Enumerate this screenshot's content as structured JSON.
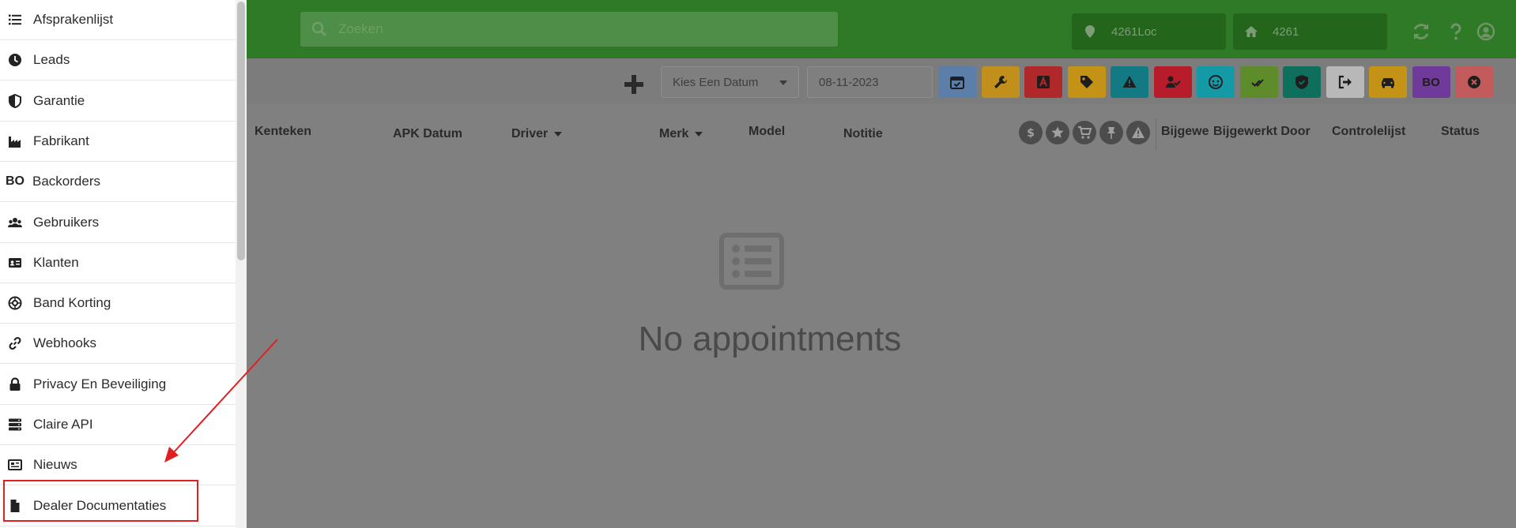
{
  "topbar": {
    "search_placeholder": "Zoeken",
    "location": "4261Loc",
    "home": "4261",
    "icons": [
      "refresh-icon",
      "help-icon",
      "user-icon"
    ],
    "color": "#2f7a27"
  },
  "toolbar": {
    "date_select": "Kies Een Datum",
    "date_value": "08-11-2023",
    "filter_buttons": [
      {
        "name": "calendar",
        "color": "#5b7fa8"
      },
      {
        "name": "wrench",
        "color": "#c08f1c"
      },
      {
        "name": "letter-a",
        "color": "#b1282a"
      },
      {
        "name": "tag",
        "color": "#c49316"
      },
      {
        "name": "warning",
        "color": "#137a84"
      },
      {
        "name": "user-check",
        "color": "#b71c2a"
      },
      {
        "name": "face",
        "color": "#139aa6"
      },
      {
        "name": "double-check",
        "color": "#5f8c2a"
      },
      {
        "name": "shield",
        "color": "#0d6f5c"
      },
      {
        "name": "sign-out",
        "color": "#b8b8b8"
      },
      {
        "name": "car",
        "color": "#c49316"
      },
      {
        "name": "bo",
        "label": "BO",
        "color": "#6f3a9a"
      },
      {
        "name": "close",
        "color": "#c25c5c"
      }
    ]
  },
  "table": {
    "columns": {
      "kenteken": "Kenteken",
      "apk_datum": "APK Datum",
      "driver": "Driver",
      "merk": "Merk",
      "model": "Model",
      "notitie": "Notitie",
      "bijgewerkt_short": "Bijgewe",
      "bijgewerkt_door": "Bijgewerkt Door",
      "controlelijst": "Controlelijst",
      "status": "Status"
    },
    "status_icons": [
      "dollar-icon",
      "star-icon",
      "cart-icon",
      "pin-icon",
      "warning-icon"
    ],
    "empty_text": "No appointments"
  },
  "sidebar": {
    "items": [
      {
        "label": "Afsprakenlijst",
        "icon": "list-icon"
      },
      {
        "label": "Leads",
        "icon": "clock-icon"
      },
      {
        "label": "Garantie",
        "icon": "shield-half-icon"
      },
      {
        "label": "Fabrikant",
        "icon": "industry-icon"
      },
      {
        "label": "Backorders",
        "icon": "bo-icon",
        "glyph": "BO"
      },
      {
        "label": "Gebruikers",
        "icon": "users-icon"
      },
      {
        "label": "Klanten",
        "icon": "id-card-icon"
      },
      {
        "label": "Band Korting",
        "icon": "tire-icon"
      },
      {
        "label": "Webhooks",
        "icon": "link-icon"
      },
      {
        "label": "Privacy En Beveiliging",
        "icon": "lock-icon"
      },
      {
        "label": "Claire API",
        "icon": "server-icon"
      },
      {
        "label": "Nieuws",
        "icon": "newspaper-icon"
      },
      {
        "label": "Dealer Documentaties",
        "icon": "file-icon"
      }
    ],
    "highlight_color": "#e02020"
  }
}
